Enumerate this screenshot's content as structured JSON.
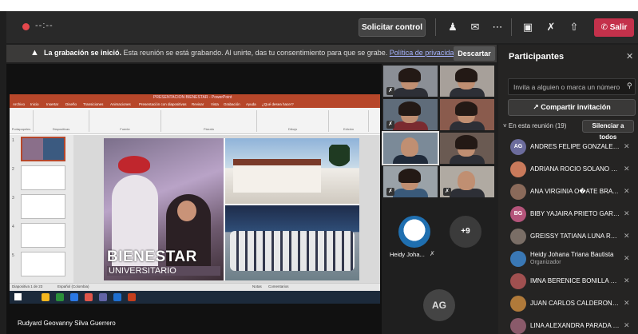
{
  "topbar": {
    "timer": "--:--",
    "request_control": "Solicitar control",
    "leave": "Salir",
    "icons": [
      "participants-icon",
      "chat-icon",
      "more-icon",
      "camera-off-icon",
      "mic-off-icon",
      "share-icon",
      "phone-icon"
    ]
  },
  "banner": {
    "bold": "La grabación se inició.",
    "text": "Esta reunión se está grabando. Al unirte, das tu consentimiento para que se grabe.",
    "link": "Política de privacidad",
    "dismiss": "Descartar"
  },
  "shared_screen": {
    "app_title": "PRESENTACION BIENESTAR - PowerPoint",
    "ribbon_tabs": [
      "Archivo",
      "Inicio",
      "Insertar",
      "Diseño",
      "Transiciones",
      "Animaciones",
      "Presentación con diapositivas",
      "Revisar",
      "Vista",
      "Grabación",
      "Ayuda",
      "¿Qué desea hacer?"
    ],
    "ribbon_groups": [
      "Portapapeles",
      "Diapositivas",
      "Fuente",
      "Párrafo",
      "Dibujo",
      "Edición"
    ],
    "thumbnail_numbers": [
      "1",
      "2",
      "3",
      "4",
      "5"
    ],
    "slide": {
      "title": "BIENESTAR",
      "subtitle": "UNIVERSITARIO"
    },
    "status": {
      "slide_counter": "Diapositiva 1 de 23",
      "language": "Español (Colombia)",
      "notes": "Notas",
      "comments": "Comentarios"
    },
    "presenter": "Rudyard Geovanny Silva Guerrero"
  },
  "grid": {
    "logo_name": "Heidy Joha...",
    "more_count": "+9",
    "self_initials": "AG"
  },
  "panel": {
    "title": "Participantes",
    "search_placeholder": "Invita a alguien o marca un número",
    "share_invite": "Compartir invitación",
    "section_label": "En esta reunión (19)",
    "mute_all": "Silenciar a todos",
    "participants": [
      {
        "initials": "AG",
        "name": "ANDRES FELIPE GONZALEZ G...",
        "role": "",
        "color": "#6c6c9c"
      },
      {
        "initials": "",
        "name": "ADRIANA ROCIO SOLANO P...",
        "role": "",
        "color": "#c97a5b"
      },
      {
        "initials": "",
        "name": "ANA VIRGINIA O�ATE BRAVO",
        "role": "",
        "color": "#8a6a5a"
      },
      {
        "initials": "BG",
        "name": "BIBY YAJAIRA PRIETO GARCIA",
        "role": "",
        "color": "#b4547a"
      },
      {
        "initials": "",
        "name": "GREISSY TATIANA LUNA ROD...",
        "role": "",
        "color": "#7a6e66"
      },
      {
        "initials": "",
        "name": "Heidy Johana Triana Bautista",
        "role": "Organizador",
        "color": "#3a78b5"
      },
      {
        "initials": "",
        "name": "IMNA BERENICE BONILLA HE...",
        "role": "",
        "color": "#a05050"
      },
      {
        "initials": "",
        "name": "JUAN CARLOS CALDERON VE...",
        "role": "",
        "color": "#b07a3a"
      },
      {
        "initials": "",
        "name": "LINA ALEXANDRA PARADA M...",
        "role": "",
        "color": "#8a5a6a"
      }
    ]
  },
  "colors": {
    "leave_button": "#c4314b",
    "panel_bg": "#252423",
    "stage_bg": "#1f1f1f",
    "ppt_accent": "#b7472a"
  }
}
